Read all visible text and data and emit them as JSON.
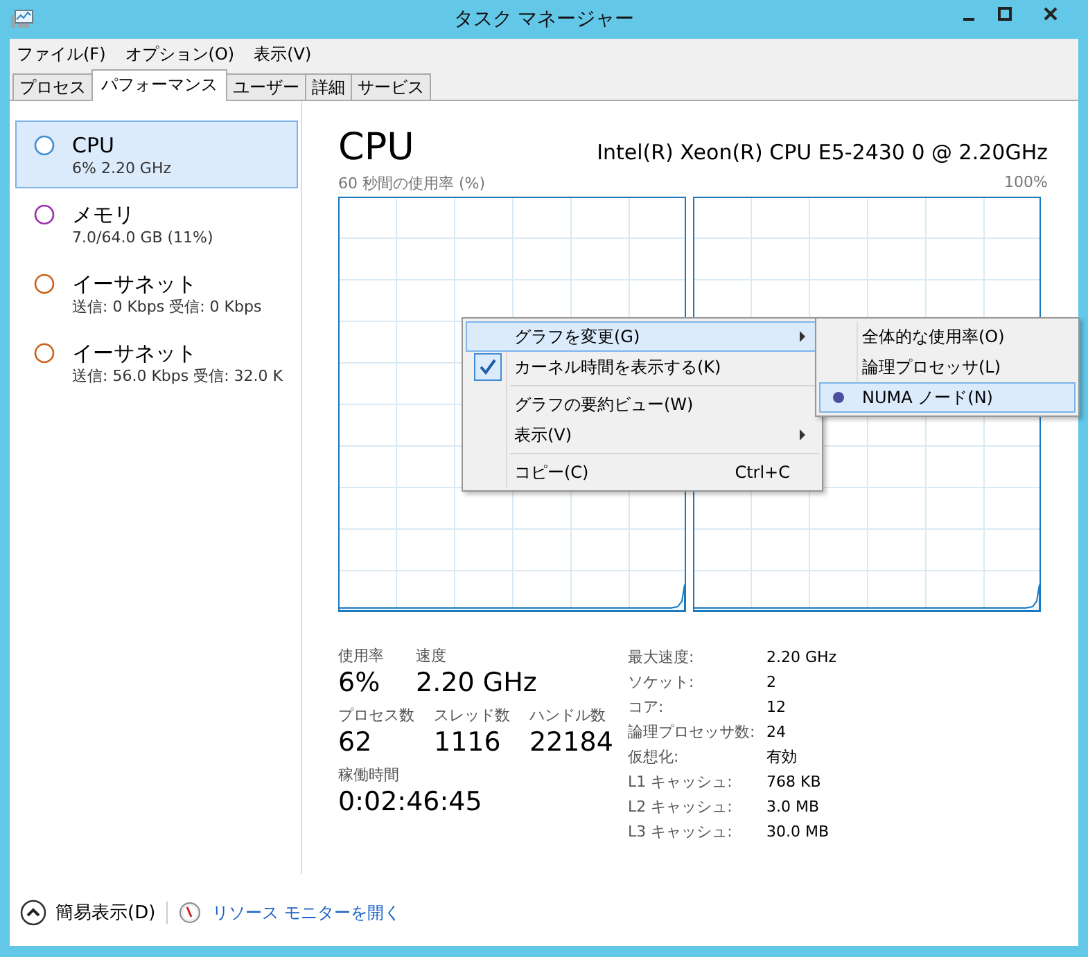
{
  "window": {
    "title": "タスク マネージャー"
  },
  "menu_bar": [
    "ファイル(F)",
    "オプション(O)",
    "表示(V)"
  ],
  "tabs": [
    {
      "label": "プロセス",
      "selected": false
    },
    {
      "label": "パフォーマンス",
      "selected": true
    },
    {
      "label": "ユーザー",
      "selected": false
    },
    {
      "label": "詳細",
      "selected": false
    },
    {
      "label": "サービス",
      "selected": false
    }
  ],
  "sidebar": {
    "items": [
      {
        "name": "CPU",
        "detail": "6% 2.20 GHz",
        "color": "#3c8ed0",
        "selected": true
      },
      {
        "name": "メモリ",
        "detail": "7.0/64.0 GB (11%)",
        "color": "#9b2fae",
        "selected": false
      },
      {
        "name": "イーサネット",
        "detail": "送信: 0 Kbps 受信: 0 Kbps",
        "color": "#c8631c",
        "selected": false
      },
      {
        "name": "イーサネット",
        "detail": "送信: 56.0 Kbps 受信: 32.0 K",
        "color": "#c8631c",
        "selected": false
      }
    ]
  },
  "detail": {
    "title": "CPU",
    "model": "Intel(R) Xeon(R) CPU E5-2430 0 @ 2.20GHz",
    "graph_label": "60 秒間の使用率 (%)",
    "graph_max": "100%",
    "stats": [
      [
        {
          "label": "使用率",
          "value": "6%"
        },
        {
          "label": "速度",
          "value": "2.20 GHz"
        }
      ],
      [
        {
          "label": "プロセス数",
          "value": "62"
        },
        {
          "label": "スレッド数",
          "value": "1116"
        },
        {
          "label": "ハンドル数",
          "value": "22184"
        }
      ],
      [
        {
          "label": "稼働時間",
          "value": "0:02:46:45"
        }
      ]
    ],
    "specs": [
      {
        "label": "最大速度:",
        "value": "2.20 GHz"
      },
      {
        "label": "ソケット:",
        "value": "2"
      },
      {
        "label": "コア:",
        "value": "12"
      },
      {
        "label": "論理プロセッサ数:",
        "value": "24"
      },
      {
        "label": "仮想化:",
        "value": "有効"
      },
      {
        "label": "L1 キャッシュ:",
        "value": "768 KB"
      },
      {
        "label": "L2 キャッシュ:",
        "value": "3.0 MB"
      },
      {
        "label": "L3 キャッシュ:",
        "value": "30.0 MB"
      }
    ]
  },
  "context_menu": {
    "items": [
      {
        "kind": "item",
        "label": "グラフを変更(G)",
        "selected": true,
        "checked": false,
        "has_submenu": true
      },
      {
        "kind": "item",
        "label": "カーネル時間を表示する(K)",
        "selected": false,
        "checked": true,
        "has_submenu": false
      },
      {
        "kind": "separator"
      },
      {
        "kind": "item",
        "label": "グラフの要約ビュー(W)",
        "selected": false,
        "checked": false,
        "has_submenu": false
      },
      {
        "kind": "item",
        "label": "表示(V)",
        "selected": false,
        "checked": false,
        "has_submenu": true
      },
      {
        "kind": "separator"
      },
      {
        "kind": "item",
        "label": "コピー(C)",
        "shortcut": "Ctrl+C",
        "selected": false,
        "checked": false,
        "has_submenu": false
      }
    ]
  },
  "submenu": {
    "items": [
      {
        "label": "全体的な使用率(O)",
        "selected": false,
        "checked": false
      },
      {
        "label": "論理プロセッサ(L)",
        "selected": false,
        "checked": false
      },
      {
        "label": "NUMA ノード(N)",
        "selected": true,
        "checked": true
      }
    ]
  },
  "footer": {
    "fewer_details": "簡易表示(D)",
    "resource_monitor_link": "リソース モニターを開く"
  }
}
